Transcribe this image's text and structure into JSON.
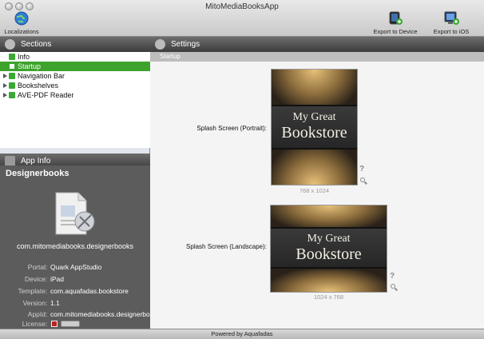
{
  "window": {
    "title": "MitoMediaBooksApp"
  },
  "toolbar": {
    "localizations_label": "Localizations",
    "export_device_label": "Export to Device",
    "export_simulator_label": "Export to iOS Simulator"
  },
  "sections": {
    "header": "Sections",
    "items": [
      {
        "label": "Info",
        "selected": false,
        "expandable": false
      },
      {
        "label": "Startup",
        "selected": true,
        "expandable": false
      },
      {
        "label": "Navigation Bar",
        "selected": false,
        "expandable": true
      },
      {
        "label": "Bookshelves",
        "selected": false,
        "expandable": true
      },
      {
        "label": "AVE-PDF Reader",
        "selected": false,
        "expandable": true
      }
    ]
  },
  "app_info": {
    "header": "App Info",
    "name": "Designerbooks",
    "bundle_id": "com.mitomediabooks.designerbooks",
    "fields": [
      {
        "key": "Portal",
        "value": "Quark AppStudio"
      },
      {
        "key": "Device",
        "value": "iPad"
      },
      {
        "key": "Template",
        "value": "com.aquafadas.bookstore"
      },
      {
        "key": "Version",
        "value": "1.1"
      },
      {
        "key": "AppId",
        "value": "com.mitomediabooks.designerbooks"
      },
      {
        "key": "License",
        "value": ""
      }
    ]
  },
  "settings": {
    "header": "Settings",
    "subheader": "Startup",
    "portrait": {
      "label": "Splash Screen (Portrait):",
      "line1": "My Great",
      "line2": "Bookstore",
      "dims": "768 x 1024",
      "help": "?"
    },
    "landscape": {
      "label": "Splash Screen (Landscape):",
      "line1": "My Great",
      "line2": "Bookstore",
      "dims": "1024 x 768",
      "help": "?"
    }
  },
  "footer": {
    "text": "Powered by Aquafadas"
  },
  "colors": {
    "selection": "#3da32c",
    "sidebar": "#e1e6ed",
    "info_bg": "#5c5c5c"
  }
}
